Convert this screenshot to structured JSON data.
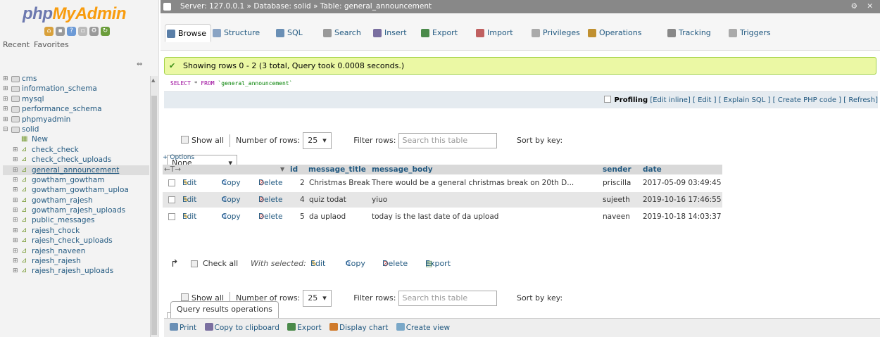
{
  "app": {
    "logo_php": "php",
    "logo_admin": "MyAdmin",
    "recent_label": "Recent",
    "favorites_label": "Favorites"
  },
  "nav_tree": [
    {
      "label": "cms",
      "level": 0
    },
    {
      "label": "information_schema",
      "level": 0
    },
    {
      "label": "mysql",
      "level": 0
    },
    {
      "label": "performance_schema",
      "level": 0
    },
    {
      "label": "phpmyadmin",
      "level": 0
    },
    {
      "label": "solid",
      "level": 0
    },
    {
      "label": "New",
      "level": 1
    },
    {
      "label": "check_check",
      "level": 1
    },
    {
      "label": "check_check_uploads",
      "level": 1
    },
    {
      "label": "general_announcement",
      "level": 1,
      "current": true
    },
    {
      "label": "gowtham_gowtham",
      "level": 1
    },
    {
      "label": "gowtham_gowtham_uploa",
      "level": 1
    },
    {
      "label": "gowtham_rajesh",
      "level": 1
    },
    {
      "label": "gowtham_rajesh_uploads",
      "level": 1
    },
    {
      "label": "public_messages",
      "level": 1
    },
    {
      "label": "rajesh_chock",
      "level": 1
    },
    {
      "label": "rajesh_check_uploads",
      "level": 1
    },
    {
      "label": "rajesh_naveen",
      "level": 1
    },
    {
      "label": "rajesh_rajesh",
      "level": 1
    },
    {
      "label": "rajesh_rajesh_uploads",
      "level": 1
    }
  ],
  "breadcrumb": "Server: 127.0.0.1 » Database: solid » Table: general_announcement",
  "tabs": [
    {
      "label": "Browse",
      "active": true,
      "color": "#5a7fa8"
    },
    {
      "label": "Structure",
      "color": "#8aa4c4"
    },
    {
      "label": "SQL",
      "color": "#6a8fb5"
    },
    {
      "label": "Search",
      "color": "#999999"
    },
    {
      "label": "Insert",
      "color": "#7a6fa0"
    },
    {
      "label": "Export",
      "color": "#4a8a4a"
    },
    {
      "label": "Import",
      "color": "#c06060"
    },
    {
      "label": "Privileges",
      "color": "#aaaaaa"
    },
    {
      "label": "Operations",
      "color": "#c09030"
    },
    {
      "label": "Tracking",
      "color": "#888888"
    },
    {
      "label": "Triggers",
      "color": "#aaaaaa"
    }
  ],
  "success_message": "Showing rows 0 - 2 (3 total, Query took 0.0008 seconds.)",
  "sql_query": {
    "select": "SELECT",
    "star": " * ",
    "from": "FROM",
    "table": " `general_announcement`"
  },
  "profiling": {
    "label": "Profiling",
    "links": "[Edit inline] [ Edit ] [ Explain SQL ] [ Create PHP code ] [ Refresh]"
  },
  "nav_controls": {
    "show_all": "Show all",
    "number_of_rows_label": "Number of rows:",
    "number_of_rows_value": "25",
    "filter_rows_label": "Filter rows:",
    "filter_placeholder": "Search this table",
    "sort_by_key_label": "Sort by key:",
    "sort_by_key_value": "None"
  },
  "options_label": "+ Options",
  "table": {
    "columns": [
      "id",
      "message_title",
      "message_body",
      "sender",
      "date"
    ],
    "actions": {
      "edit": "Edit",
      "copy": "Copy",
      "delete": "Delete"
    },
    "rows": [
      {
        "id": "2",
        "message_title": "Christmas Break",
        "message_body": "There would be a general christmas break on 20th D...",
        "sender": "priscilla",
        "date": "2017-05-09 03:49:45"
      },
      {
        "id": "4",
        "message_title": "quiz todat",
        "message_body": "yiuo",
        "sender": "sujeeth",
        "date": "2019-10-16 17:46:55"
      },
      {
        "id": "5",
        "message_title": "da uplaod",
        "message_body": "today is the last date of da upload",
        "sender": "naveen",
        "date": "2019-10-18 14:03:37"
      }
    ]
  },
  "with_selected": {
    "check_all": "Check all",
    "label": "With selected:",
    "edit": "Edit",
    "copy": "Copy",
    "delete": "Delete",
    "export": "Export"
  },
  "query_results_operations": {
    "title": "Query results operations",
    "print": "Print",
    "copy_clipboard": "Copy to clipboard",
    "export": "Export",
    "display_chart": "Display chart",
    "create_view": "Create view"
  }
}
